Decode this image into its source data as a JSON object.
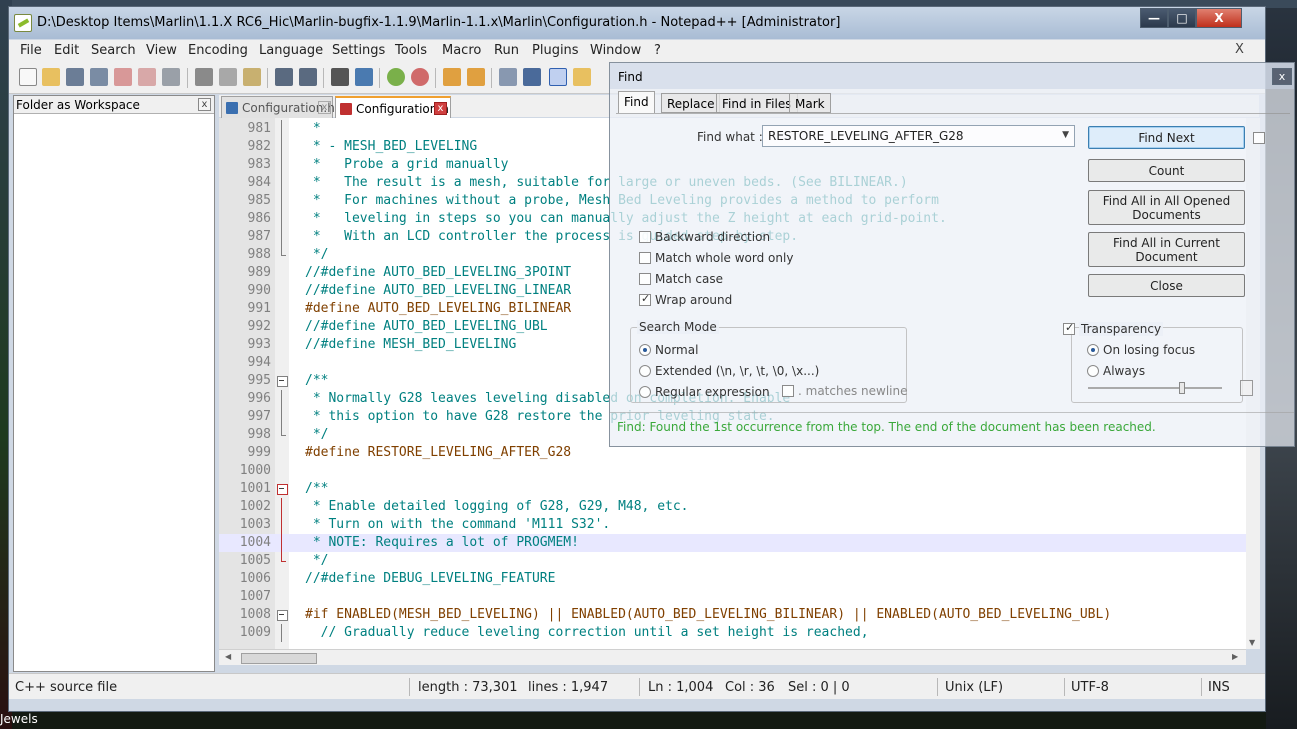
{
  "desktop": {
    "bottom_label": "Jewels"
  },
  "window": {
    "title": "D:\\Desktop Items\\Marlin\\1.1.X RC6_Hic\\Marlin-bugfix-1.1.9\\Marlin-1.1.x\\Marlin\\Configuration.h - Notepad++ [Administrator]",
    "controls": {
      "minimize": "—",
      "maximize": "□",
      "close": "X"
    }
  },
  "menu": {
    "items": [
      "File",
      "Edit",
      "Search",
      "View",
      "Encoding",
      "Language",
      "Settings",
      "Tools",
      "Macro",
      "Run",
      "Plugins",
      "Window",
      "?"
    ],
    "close_doc": "X"
  },
  "folder_panel": {
    "title": "Folder as Workspace",
    "close": "x"
  },
  "tabs": [
    {
      "label": "Configuration.h",
      "close": "x"
    },
    {
      "label": "Configuration.h",
      "close": "x"
    }
  ],
  "editor": {
    "highlighted_line": 1004,
    "lines": [
      {
        "n": "981",
        "t": " *",
        "k": "comment",
        "f": "line"
      },
      {
        "n": "982",
        "t": " * - MESH_BED_LEVELING",
        "k": "comment",
        "f": "line"
      },
      {
        "n": "983",
        "t": " *   Probe a grid manually",
        "k": "comment",
        "f": "line"
      },
      {
        "n": "984",
        "t": " *   The result is a mesh, suitable for large or uneven beds. (See BILINEAR.)",
        "k": "comment",
        "f": "line"
      },
      {
        "n": "985",
        "t": " *   For machines without a probe, Mesh Bed Leveling provides a method to perform",
        "k": "comment",
        "f": "line"
      },
      {
        "n": "986",
        "t": " *   leveling in steps so you can manually adjust the Z height at each grid-point.",
        "k": "comment",
        "f": "line"
      },
      {
        "n": "987",
        "t": " *   With an LCD controller the process is guided step-by-step.",
        "k": "comment",
        "f": "line"
      },
      {
        "n": "988",
        "t": " */",
        "k": "comment",
        "f": "end"
      },
      {
        "n": "989",
        "t": "//#define AUTO_BED_LEVELING_3POINT",
        "k": "comment",
        "f": ""
      },
      {
        "n": "990",
        "t": "//#define AUTO_BED_LEVELING_LINEAR",
        "k": "comment",
        "f": ""
      },
      {
        "n": "991",
        "t": "#define AUTO_BED_LEVELING_BILINEAR",
        "k": "pre",
        "f": ""
      },
      {
        "n": "992",
        "t": "//#define AUTO_BED_LEVELING_UBL",
        "k": "comment",
        "f": ""
      },
      {
        "n": "993",
        "t": "//#define MESH_BED_LEVELING",
        "k": "comment",
        "f": ""
      },
      {
        "n": "994",
        "t": "",
        "k": "comment",
        "f": ""
      },
      {
        "n": "995",
        "t": "/**",
        "k": "comment",
        "f": "box"
      },
      {
        "n": "996",
        "t": " * Normally G28 leaves leveling disabled on completion. Enable",
        "k": "comment",
        "f": "line"
      },
      {
        "n": "997",
        "t": " * this option to have G28 restore the prior leveling state.",
        "k": "comment",
        "f": "line"
      },
      {
        "n": "998",
        "t": " */",
        "k": "comment",
        "f": "end"
      },
      {
        "n": "999",
        "t": "#define RESTORE_LEVELING_AFTER_G28",
        "k": "pre",
        "f": ""
      },
      {
        "n": "1000",
        "t": "",
        "k": "comment",
        "f": ""
      },
      {
        "n": "1001",
        "t": "/**",
        "k": "comment",
        "f": "box red"
      },
      {
        "n": "1002",
        "t": " * Enable detailed logging of G28, G29, M48, etc.",
        "k": "comment",
        "f": "line red"
      },
      {
        "n": "1003",
        "t": " * Turn on with the command 'M111 S32'.",
        "k": "comment",
        "f": "line red"
      },
      {
        "n": "1004",
        "t": " * NOTE: Requires a lot of PROGMEM!",
        "k": "comment",
        "f": "line red"
      },
      {
        "n": "1005",
        "t": " */",
        "k": "comment",
        "f": "end red"
      },
      {
        "n": "1006",
        "t": "//#define DEBUG_LEVELING_FEATURE",
        "k": "comment",
        "f": ""
      },
      {
        "n": "1007",
        "t": "",
        "k": "comment",
        "f": ""
      },
      {
        "n": "1008",
        "t": "#if ENABLED(MESH_BED_LEVELING) || ENABLED(AUTO_BED_LEVELING_BILINEAR) || ENABLED(AUTO_BED_LEVELING_UBL)",
        "k": "pre",
        "f": "box"
      },
      {
        "n": "1009",
        "t": "  // Gradually reduce leveling correction until a set height is reached,",
        "k": "comment",
        "f": "line"
      }
    ]
  },
  "statusbar": {
    "filetype": "C++ source file",
    "length": "length : 73,301",
    "lines": "lines : 1,947",
    "ln": "Ln : 1,004",
    "col": "Col : 36",
    "sel": "Sel : 0 | 0",
    "eol": "Unix (LF)",
    "encoding": "UTF-8",
    "mode": "INS"
  },
  "find_dialog": {
    "title": "Find",
    "close": "x",
    "tabs": [
      "Find",
      "Replace",
      "Find in Files",
      "Mark"
    ],
    "active_tab": "Find",
    "find_what_label": "Find what :",
    "find_what_value": "RESTORE_LEVELING_AFTER_G28",
    "buttons": {
      "find_next": "Find Next",
      "count": "Count",
      "find_all_opened": "Find All in All Opened Documents",
      "find_all_current": "Find All in Current Document",
      "close": "Close"
    },
    "options": {
      "backward": {
        "label": "Backward direction",
        "checked": false
      },
      "whole_word": {
        "label": "Match whole word only",
        "checked": false
      },
      "match_case": {
        "label": "Match case",
        "checked": false
      },
      "wrap_around": {
        "label": "Wrap around",
        "checked": true
      }
    },
    "search_mode": {
      "title": "Search Mode",
      "normal": "Normal",
      "extended": "Extended (\\n, \\r, \\t, \\0, \\x...)",
      "regex": "Regular expression",
      "matches_newline": ". matches newline",
      "selected": "Normal"
    },
    "transparency": {
      "title": "Transparency",
      "enabled": true,
      "on_losing_focus": "On losing focus",
      "always": "Always",
      "selected": "On losing focus",
      "level": 0.7
    },
    "status": "Find: Found the 1st occurrence from the top. The end of the document has been reached."
  },
  "colors": {
    "comment": "#008080",
    "preprocessor": "#804000",
    "status_ok": "#3aa83a",
    "active_tab_accent": "#f0a030"
  }
}
